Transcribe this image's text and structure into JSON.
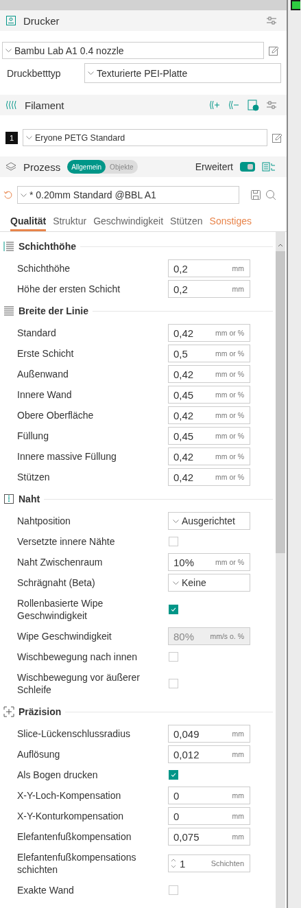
{
  "printer": {
    "title": "Drucker",
    "preset": "Bambu Lab A1 0.4 nozzle",
    "bed_label": "Druckbetttyp",
    "bed_value": "Texturierte PEI-Platte"
  },
  "filament": {
    "title": "Filament",
    "items": [
      {
        "index": "1",
        "name": "Eryone PETG Standard"
      }
    ]
  },
  "process": {
    "title": "Prozess",
    "modes": [
      {
        "label": "Allgemein",
        "selected": true
      },
      {
        "label": "Objekte",
        "selected": false
      }
    ],
    "advanced_label": "Erweitert",
    "advanced": true,
    "preset": "* 0.20mm Standard @BBL A1"
  },
  "tabs": [
    {
      "label": "Qualität",
      "selected": true,
      "modified": false
    },
    {
      "label": "Struktur",
      "selected": false,
      "modified": false
    },
    {
      "label": "Geschwindigkeit",
      "selected": false,
      "modified": false
    },
    {
      "label": "Stützen",
      "selected": false,
      "modified": false
    },
    {
      "label": "Sonstiges",
      "selected": false,
      "modified": true
    }
  ],
  "sections": [
    {
      "title": "Schichthöhe",
      "options": [
        {
          "kind": "input",
          "label": "Schichthöhe",
          "value": "0,2",
          "unit": "mm"
        },
        {
          "kind": "input",
          "label": "Höhe der ersten Schicht",
          "value": "0,2",
          "unit": "mm"
        }
      ]
    },
    {
      "title": "Breite der Linie",
      "options": [
        {
          "kind": "input",
          "label": "Standard",
          "value": "0,42",
          "unit": "mm or %"
        },
        {
          "kind": "input",
          "label": "Erste Schicht",
          "value": "0,5",
          "unit": "mm or %"
        },
        {
          "kind": "input",
          "label": "Außenwand",
          "value": "0,42",
          "unit": "mm or %"
        },
        {
          "kind": "input",
          "label": "Innere Wand",
          "value": "0,45",
          "unit": "mm or %"
        },
        {
          "kind": "input",
          "label": "Obere Oberfläche",
          "value": "0,42",
          "unit": "mm or %"
        },
        {
          "kind": "input",
          "label": "Füllung",
          "value": "0,45",
          "unit": "mm or %"
        },
        {
          "kind": "input",
          "label": "Innere massive Füllung",
          "value": "0,42",
          "unit": "mm or %"
        },
        {
          "kind": "input",
          "label": "Stützen",
          "value": "0,42",
          "unit": "mm or %"
        }
      ]
    },
    {
      "title": "Naht",
      "options": [
        {
          "kind": "combo",
          "label": "Nahtposition",
          "value": "Ausgerichtet"
        },
        {
          "kind": "checkbox",
          "label": "Versetzte innere Nähte",
          "checked": false
        },
        {
          "kind": "input",
          "label": "Naht Zwischenraum",
          "value": "10%",
          "unit": "mm or %"
        },
        {
          "kind": "combo",
          "label": "Schrägnaht (Beta)",
          "value": "Keine"
        },
        {
          "kind": "checkbox",
          "label": "Rollenbasierte Wipe Geschwindigkeit",
          "checked": true
        },
        {
          "kind": "input",
          "label": "Wipe Geschwindigkeit",
          "value": "80%",
          "unit": "mm/s o. %",
          "disabled": true
        },
        {
          "kind": "checkbox",
          "label": "Wischbewegung nach innen",
          "checked": false
        },
        {
          "kind": "checkbox",
          "label": "Wischbewegung vor äußerer Schleife",
          "checked": false
        }
      ]
    },
    {
      "title": "Präzision",
      "options": [
        {
          "kind": "input",
          "label": "Slice-Lückenschlussradius",
          "value": "0,049",
          "unit": "mm"
        },
        {
          "kind": "input",
          "label": "Auflösung",
          "value": "0,012",
          "unit": "mm"
        },
        {
          "kind": "checkbox",
          "label": "Als Bogen drucken",
          "checked": true
        },
        {
          "kind": "input",
          "label": "X-Y-Loch-Kompensation",
          "value": "0",
          "unit": "mm"
        },
        {
          "kind": "input",
          "label": "X-Y-Konturkompensation",
          "value": "0",
          "unit": "mm"
        },
        {
          "kind": "input",
          "label": "Elefantenfußkompensation",
          "value": "0,075",
          "unit": "mm"
        },
        {
          "kind": "spin",
          "label": "Elefantenfußkompensations schichten",
          "value": "1",
          "unit": "Schichten"
        },
        {
          "kind": "checkbox",
          "label": "Exakte Wand",
          "checked": false
        }
      ]
    }
  ]
}
